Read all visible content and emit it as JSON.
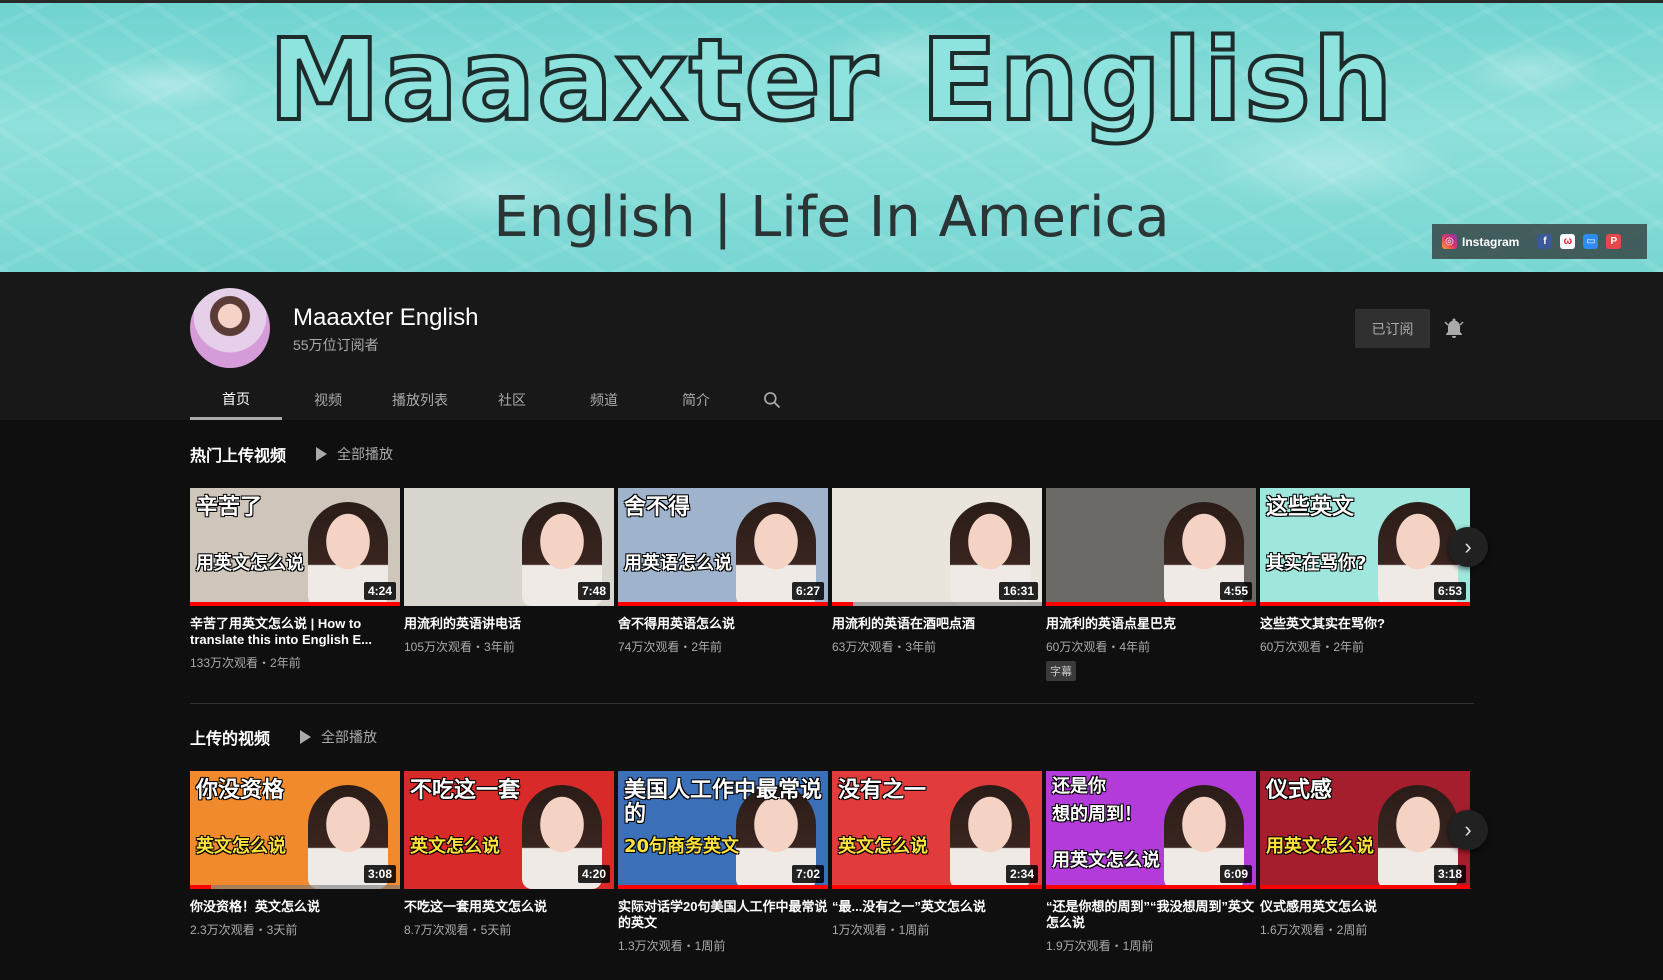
{
  "banner": {
    "title": "Maaaxter English",
    "subtitle": "English | Life In America",
    "instagram_label": "Instagram"
  },
  "channel": {
    "name": "Maaaxter English",
    "subscribers": "55万位订阅者",
    "subscribed_label": "已订阅"
  },
  "tabs": [
    "首页",
    "视频",
    "播放列表",
    "社区",
    "频道",
    "简介"
  ],
  "shelves": [
    {
      "title": "热门上传视频",
      "play_all": "全部播放",
      "videos": [
        {
          "title": "辛苦了用英文怎么说 | How to translate this into English E...",
          "meta": "133万次观看・2年前",
          "duration": "4:24",
          "thumb_text": [
            "辛苦了",
            "用英文怎么说"
          ],
          "progress": 1.0,
          "bg": "#cfc6bb"
        },
        {
          "title": "用流利的英语讲电话",
          "meta": "105万次观看・3年前",
          "duration": "7:48",
          "thumb_text": [],
          "progress": 0,
          "bg": "#d9d6d0"
        },
        {
          "title": "舍不得用英语怎么说",
          "meta": "74万次观看・2年前",
          "duration": "6:27",
          "thumb_text": [
            "舍不得",
            "用英语怎么说"
          ],
          "progress": 1.0,
          "bg": "#9fb4cc"
        },
        {
          "title": "用流利的英语在酒吧点酒",
          "meta": "63万次观看・3年前",
          "duration": "16:31",
          "thumb_text": [],
          "progress": 0.1,
          "bg": "#e9e4dc"
        },
        {
          "title": "用流利的英语点星巴克",
          "meta": "60万次观看・4年前",
          "duration": "4:55",
          "thumb_text": [],
          "progress": 1.0,
          "bg": "#6c6a66",
          "badge": "字幕"
        },
        {
          "title": "这些英文其实在骂你?",
          "meta": "60万次观看・2年前",
          "duration": "6:53",
          "thumb_text": [
            "这些英文",
            "其实在骂你?"
          ],
          "progress": 1.0,
          "bg": "#9fe6dd"
        }
      ]
    },
    {
      "title": "上传的视频",
      "play_all": "全部播放",
      "videos": [
        {
          "title": "你没资格！英文怎么说",
          "meta": "2.3万次观看・3天前",
          "duration": "3:08",
          "thumb_text": [
            "你没资格",
            "英文怎么说"
          ],
          "progress": 0.1,
          "bg": "#f08a2c"
        },
        {
          "title": "不吃这一套用英文怎么说",
          "meta": "8.7万次观看・5天前",
          "duration": "4:20",
          "thumb_text": [
            "不吃这一套",
            "英文怎么说"
          ],
          "progress": 0,
          "bg": "#d92a2a"
        },
        {
          "title": "实际对话学20句美国人工作中最常说的英文",
          "meta": "1.3万次观看・1周前",
          "duration": "7:02",
          "thumb_text": [
            "美国人工作中最常说的",
            "20句商务英文"
          ],
          "progress": 1.0,
          "bg": "#3b6fb8"
        },
        {
          "title": "“最...没有之一”英文怎么说",
          "meta": "1万次观看・1周前",
          "duration": "2:34",
          "thumb_text": [
            "没有之一",
            "英文怎么说"
          ],
          "progress": 1.0,
          "bg": "#e23b3b"
        },
        {
          "title": "“还是你想的周到”“我没想周到”英文怎么说",
          "meta": "1.9万次观看・1周前",
          "duration": "6:09",
          "thumb_text": [
            "还是你",
            "想的周到！",
            "用英文怎么说"
          ],
          "progress": 1.0,
          "bg": "#b23bd9"
        },
        {
          "title": "仪式感用英文怎么说",
          "meta": "1.6万次观看・2周前",
          "duration": "3:18",
          "thumb_text": [
            "仪式感",
            "用英文怎么说"
          ],
          "progress": 1.0,
          "bg": "#a51e2e"
        }
      ]
    }
  ],
  "icons": {
    "bell": "bell-icon",
    "search": "search-icon",
    "play": "play-icon",
    "next": "chevron-right-icon"
  },
  "colors": {
    "accent_red": "#ff0000",
    "page_bg": "#0f0f0f",
    "header_bg": "#181818"
  }
}
